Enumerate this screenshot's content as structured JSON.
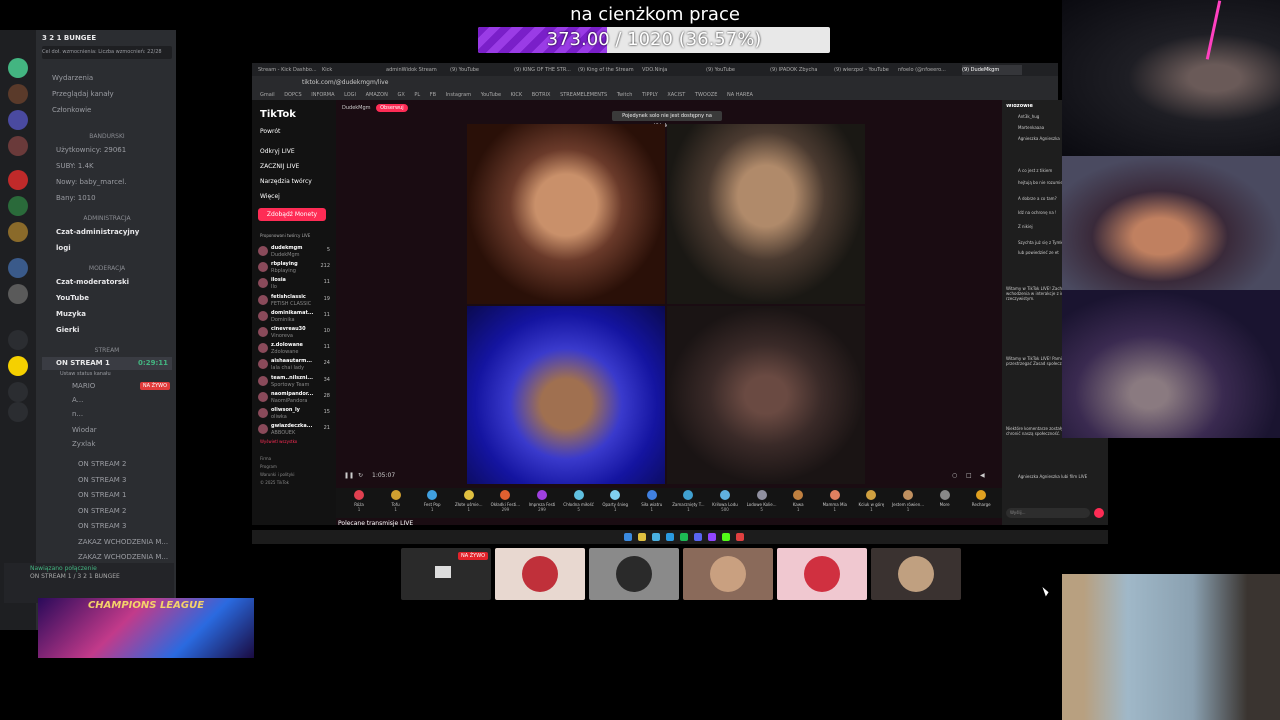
{
  "overlay": {
    "goal_title": "na cienżkom prace",
    "goal_text": "373.00 / 1020 (36.57%)",
    "goal_fraction": 0.3657
  },
  "discord": {
    "server_name": "3 2 1 BUNGEE",
    "server_sub": "Cel doł. wzmocnienia: Liczba wzmocnień: 22/28",
    "top_items": [
      "Wydarzenia",
      "Przeglądaj kanały",
      "Członkowie"
    ],
    "cat_bandurski": "BANDURSKI",
    "stats": [
      "Użytkownicy: 29061",
      "SUBY: 1.4K",
      "Nowy: baby_marcel.",
      "Bany: 1010"
    ],
    "cat_admin": "ADMINISTRACJA",
    "admin_channels": [
      "Czat-administracyjny",
      "logi"
    ],
    "cat_mod": "MODERACJA",
    "mod_channels": [
      "Czat-moderatorski",
      "YouTube",
      "Muzyka",
      "Gierki"
    ],
    "cat_stream": "STREAM",
    "stream_channel": "ON STREAM 1",
    "stream_time": "0:29:11",
    "stream_status": "Ustaw status kanału",
    "voice_users": [
      "MARIO",
      "A...",
      "n...",
      "Wiodar",
      "Zyxlak"
    ],
    "live_badge": "NA ŻYWO",
    "other_channels": [
      "ON STREAM 2",
      "ON STREAM 3",
      "ON STREAM 1",
      "ON STREAM 2",
      "ON STREAM 3",
      "ZAKAZ WCHODZENIA M...",
      "ZAKAZ WCHODZENIA M..."
    ],
    "connected": "Nawiązano połączenie",
    "connected_sub": "ON STREAM 1 / 3 2 1 BUNGEE"
  },
  "browser": {
    "tabs": [
      "Stream - Kick Dashbo...",
      "Kick",
      "adminWidok Stream",
      "(9) YouTube",
      "(9) KING OF THE STR...",
      "(9) King of the Stream",
      "VDO.Ninja",
      "(9) YouTube",
      "(9) IPADOK Zbycha",
      "(9) wierzpol - YouTube",
      "nfoelo (@nfoeero...",
      "(9) DudeMkgm"
    ],
    "url": "tiktok.com/@dudekmgm/live",
    "bookmarks": [
      "Gmail",
      "DOPCS",
      "INFORMA",
      "LOGI",
      "AMAZON",
      "GX",
      "PL",
      "FB",
      "Instagram",
      "YouTube",
      "KICK",
      "BOTRIX",
      "STREAMELEMENTS",
      "Twitch",
      "TIPPLY",
      "XACIST",
      "TWOOZE",
      "NA HAREA"
    ]
  },
  "tiktok": {
    "logo": "TikTok",
    "nav": [
      "Powrót",
      "Odkryj LIVE",
      "ZACZNIJ LIVE",
      "Narzędzia twórcy",
      "Więcej"
    ],
    "coins_button": "Zdobądź Monety",
    "suggested_title": "Proponowani twórcy LIVE",
    "suggested": [
      {
        "name": "dudekmgm",
        "sub": "DudekMgm",
        "count": "5"
      },
      {
        "name": "rbplaying",
        "sub": "Rbplaying",
        "count": "212"
      },
      {
        "name": "ilosia",
        "sub": "Ilo",
        "count": "11"
      },
      {
        "name": "fetishclassic",
        "sub": "FETISH CLASSIC",
        "count": "19"
      },
      {
        "name": "dominikamat...",
        "sub": "Dominika",
        "count": "11"
      },
      {
        "name": "cinevreau30",
        "sub": "Vinoreva",
        "count": "10"
      },
      {
        "name": "z.dolowane",
        "sub": "Zdolowane",
        "count": "11"
      },
      {
        "name": "aishaautarm...",
        "sub": "lala chai lady",
        "count": "24"
      },
      {
        "name": "team..nilszni...",
        "sub": "Sportowy Team",
        "count": "34"
      },
      {
        "name": "naomipandor...",
        "sub": "NaomiPandora",
        "count": "28"
      },
      {
        "name": "oliwson_ly",
        "sub": "oliwka",
        "count": "15"
      },
      {
        "name": "gwiazdeczka...",
        "sub": "ABBOUEK",
        "count": "21"
      }
    ],
    "show_all": "Wyświetl wszystko",
    "footer": [
      "Firma",
      "Program",
      "Warunki i polityki",
      "© 2025 TikTok"
    ],
    "host": "DudekMgm",
    "obs_button": "Obserwuj",
    "toast": "Pojedynek solo nie jest dostępny na tiktok.com",
    "timer": "1:05:07",
    "gifts": [
      {
        "name": "Róża",
        "price": "1"
      },
      {
        "name": "Tofu",
        "price": "1"
      },
      {
        "name": "Fest Pop",
        "price": "1"
      },
      {
        "name": "Złote uśmie...",
        "price": "1"
      },
      {
        "name": "Okładki Festi...",
        "price": "299"
      },
      {
        "name": "Impreza Festi",
        "price": "299"
      },
      {
        "name": "Chłodna miłość",
        "price": "5"
      },
      {
        "name": "Oparty śnieg",
        "price": "1"
      },
      {
        "name": "Siła wiatru",
        "price": "1"
      },
      {
        "name": "Zamarznięty T...",
        "price": "1"
      },
      {
        "name": "Kriłowa Lodu",
        "price": "500"
      },
      {
        "name": "Lodowe Kolie...",
        "price": "5"
      },
      {
        "name": "Kawa",
        "price": "1"
      },
      {
        "name": "Mamma Mia",
        "price": "1"
      },
      {
        "name": "Kciuk w górę",
        "price": "1"
      },
      {
        "name": "Jestem rówien...",
        "price": "1"
      },
      {
        "name": "More",
        "price": ""
      },
      {
        "name": "Recharge",
        "price": ""
      }
    ],
    "recommended": "Polecane transmisje LIVE",
    "viewers_title": "Widzowie",
    "viewers": [
      "Ant3k_hug",
      "Martenkaaaa",
      "Agnieszka Agnieszka"
    ],
    "chat": [
      "A co jest z tikiem",
      "hejtują bo nie rozumie",
      "A dobrze a co tam?",
      "Idź na ochronę na !",
      "Z nikiej",
      "Szychta już się z Tymk",
      "lub powiedzieć ze et",
      "Witamy w TikTok LIVE! Zachęcamy do wchodzenia w interakcje z innymi w czasie rzeczywistym.",
      "Witamy w TikTok LIVE! Pamiętaj, aby przestrzegać Zasad społeczności.",
      "Niektóre komentarze zostały odfiltrowane, by chronić naszą społeczność.",
      "Agnieszka Agnieszka lubi film LIVE"
    ],
    "chat_placeholder": "Wyślij..."
  },
  "bottom": {
    "live_badge": "NA ŻYWO",
    "champions_text": "CHAMPIONS LEAGUE"
  }
}
